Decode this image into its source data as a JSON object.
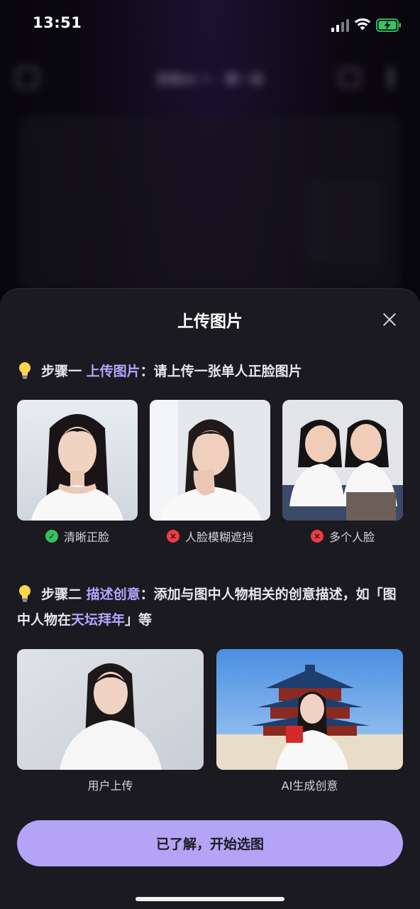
{
  "status": {
    "time": "13:51"
  },
  "background": {
    "title": "我是AI ✦ · 第一组"
  },
  "sheet": {
    "title": "上传图片",
    "step1": {
      "prefix": "步骤一",
      "highlight": "上传图片",
      "suffix": "：请上传一张单人正脸图片"
    },
    "examples": [
      {
        "label": "清晰正脸",
        "status": "correct",
        "status_mark": "✓"
      },
      {
        "label": "人脸模糊遮挡",
        "status": "incorrect",
        "status_mark": "×"
      },
      {
        "label": "多个人脸",
        "status": "incorrect",
        "status_mark": "×"
      }
    ],
    "step2": {
      "prefix": "步骤二",
      "highlight": "描述创意",
      "middle": "：添加与图中人物相关的创意描述，如「图中人物在",
      "highlight2": "天坛拜年",
      "suffix": "」等"
    },
    "demos": [
      {
        "label": "用户上传"
      },
      {
        "label": "AI生成创意"
      }
    ],
    "cta_label": "已了解，开始选图"
  },
  "colors": {
    "accent": "#b7a4ff",
    "button": "#b4a4f6",
    "sheet_bg": "#1b1a20",
    "ok": "#36c25e",
    "bad": "#ee3b45"
  }
}
